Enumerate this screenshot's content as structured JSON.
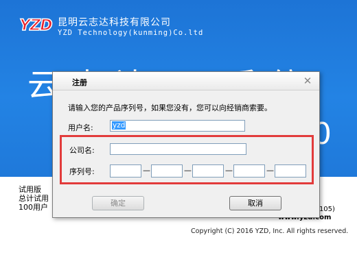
{
  "splash": {
    "logo_text": "YZD",
    "company_cn": "昆明云志达科技有限公司",
    "company_en": "YZD Technology(kunming)Co.ltd",
    "big_title": "云志达...系统",
    "big_digit": "0",
    "trial_lines": [
      "试用版",
      "总计试用",
      "100用户"
    ],
    "version": "J105)",
    "website": "www.yzd.com",
    "copyright": "Copyright (C) 2016 YZD, Inc. All rights reserved."
  },
  "dialog": {
    "title": "注册",
    "close_glyph": "✕",
    "prompt": "请输入您的产品序列号，如果您没有，您可以向经销商索要。",
    "username_label": "用户名:",
    "username_value": "yzd",
    "company_label": "公司名:",
    "company_value": "",
    "serial_label": "序列号:",
    "serial_segments": [
      "",
      "",
      "",
      "",
      ""
    ],
    "serial_separator": "—",
    "ok_label": "确定",
    "cancel_label": "取消"
  },
  "colors": {
    "splash_blue": "#2383e4",
    "highlight_red": "#e23b3b",
    "selection_blue": "#3399ff"
  }
}
